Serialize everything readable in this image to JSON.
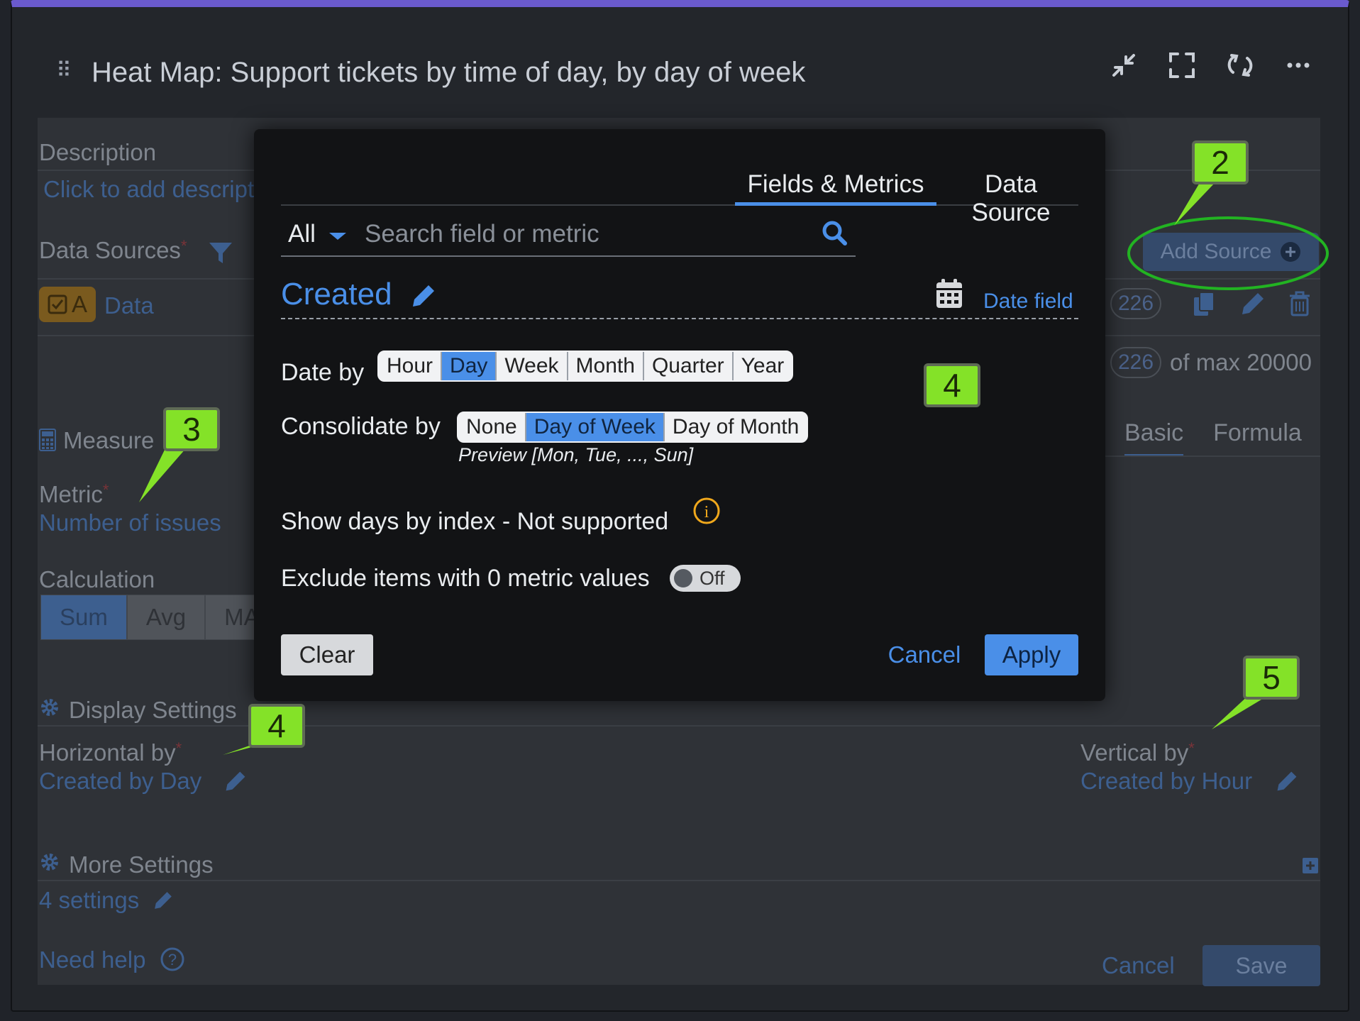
{
  "header": {
    "title": "Heat Map: Support tickets by time of day, by day of week",
    "icons": [
      "drag-handle-icon",
      "collapse-icon",
      "fullscreen-icon",
      "refresh-icon",
      "more-icon"
    ]
  },
  "background": {
    "description_label": "Description",
    "description_placeholder": "Click to add descripti",
    "data_sources_label": "Data Sources",
    "required_mark": "*",
    "add_source_label": "Add Source",
    "source": {
      "badge": "A",
      "name": "Data",
      "count": "226"
    },
    "limit": {
      "count": "226",
      "suffix": "of max 20000"
    },
    "measure_label": "Measure",
    "tabs": [
      "Basic",
      "Formula"
    ],
    "metric_label": "Metric",
    "metric_value": "Number of issues",
    "calculation_label": "Calculation",
    "calculation_options": [
      "Sum",
      "Avg",
      "MA"
    ],
    "display_settings_label": "Display Settings",
    "horizontal_label": "Horizontal by",
    "horizontal_value": "Created by Day",
    "vertical_label": "Vertical by",
    "vertical_value": "Created by Hour",
    "more_settings_label": "More Settings",
    "more_settings_value": "4 settings",
    "need_help": "Need help",
    "cancel": "Cancel",
    "save": "Save"
  },
  "modal": {
    "tabs": [
      "Fields & Metrics",
      "Data Source"
    ],
    "active_tab": "Fields & Metrics",
    "filter_value": "All",
    "search_placeholder": "Search field or metric",
    "field_name": "Created",
    "field_type": "Date field",
    "date_by_label": "Date by",
    "date_by_options": [
      "Hour",
      "Day",
      "Week",
      "Month",
      "Quarter",
      "Year"
    ],
    "date_by_selected": "Day",
    "consolidate_label": "Consolidate by",
    "consolidate_options": [
      "None",
      "Day of Week",
      "Day of Month"
    ],
    "consolidate_selected": "Day of Week",
    "preview_text": "Preview [Mon, Tue, ..., Sun]",
    "show_days_label": "Show days by index",
    "show_days_note": "- Not supported",
    "exclude_label": "Exclude items with 0 metric values",
    "exclude_toggle": "Off",
    "clear": "Clear",
    "cancel": "Cancel",
    "apply": "Apply"
  },
  "callouts": [
    "2",
    "3",
    "4",
    "4",
    "5"
  ],
  "colors": {
    "accent": "#4a8fe8",
    "callout": "#84e228",
    "highlight_ring": "#22b322",
    "top_bar": "#6a5acd"
  }
}
